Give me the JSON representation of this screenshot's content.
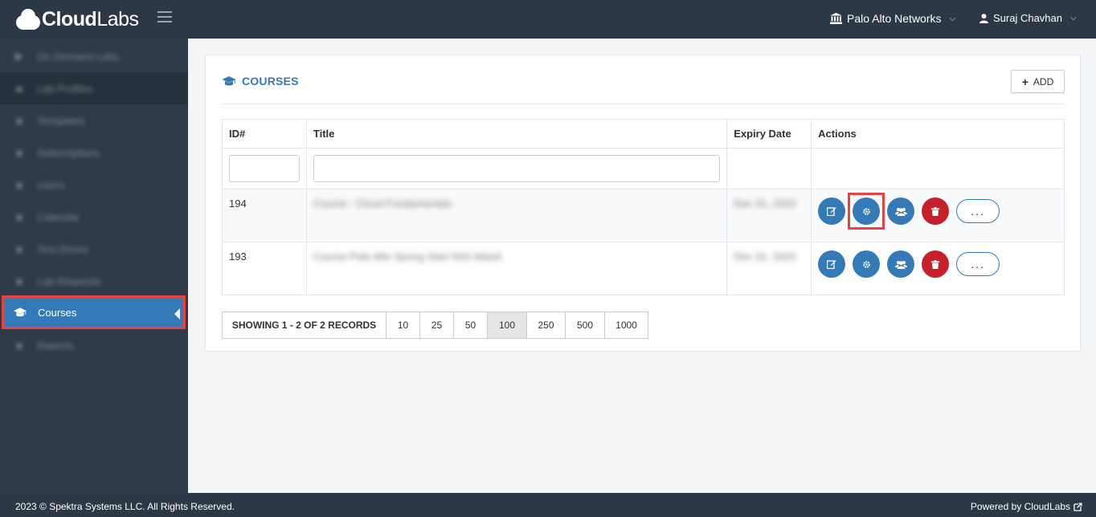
{
  "header": {
    "logo_bold": "Cloud",
    "logo_light": "Labs",
    "org_name": "Palo Alto Networks",
    "user_name": "Suraj Chavhan"
  },
  "sidebar": {
    "items": [
      {
        "label": "On Demand Labs",
        "icon": "play-icon"
      },
      {
        "label": "Lab Profiles",
        "icon": "flask-icon"
      },
      {
        "label": "Templates",
        "icon": "wrench-icon"
      },
      {
        "label": "Subscriptions",
        "icon": "briefcase-icon"
      },
      {
        "label": "Users",
        "icon": "user-icon"
      },
      {
        "label": "Calendar",
        "icon": "calendar-icon"
      },
      {
        "label": "Test Drives",
        "icon": "rocket-icon"
      },
      {
        "label": "Lab Requests",
        "icon": "inbox-icon"
      },
      {
        "label": "Courses",
        "icon": "graduation-cap-icon"
      },
      {
        "label": "Reports",
        "icon": "chart-icon"
      }
    ]
  },
  "panel": {
    "title": "COURSES",
    "add_label": "ADD"
  },
  "table": {
    "columns": [
      "ID#",
      "Title",
      "Expiry Date",
      "Actions"
    ],
    "rows": [
      {
        "id": "194",
        "title": "Course : Cloud Fundamentals",
        "expiry": "Dec 31, 2023"
      },
      {
        "id": "193",
        "title": "Course Palo Alto Spring Start NGI Attack",
        "expiry": "Dec 31, 2023"
      }
    ],
    "more_label": "..."
  },
  "pagination": {
    "info": "SHOWING 1 - 2 OF 2 RECORDS",
    "sizes": [
      "10",
      "25",
      "50",
      "100",
      "250",
      "500",
      "1000"
    ],
    "selected": "100"
  },
  "footer": {
    "copyright": "2023 © Spektra Systems LLC. All Rights Reserved.",
    "powered": "Powered by CloudLabs"
  },
  "colors": {
    "topbar": "#2c3846",
    "sidebar": "#2f3a48",
    "primary": "#337ab7",
    "danger": "#c8202b",
    "highlight": "#e9413f"
  }
}
